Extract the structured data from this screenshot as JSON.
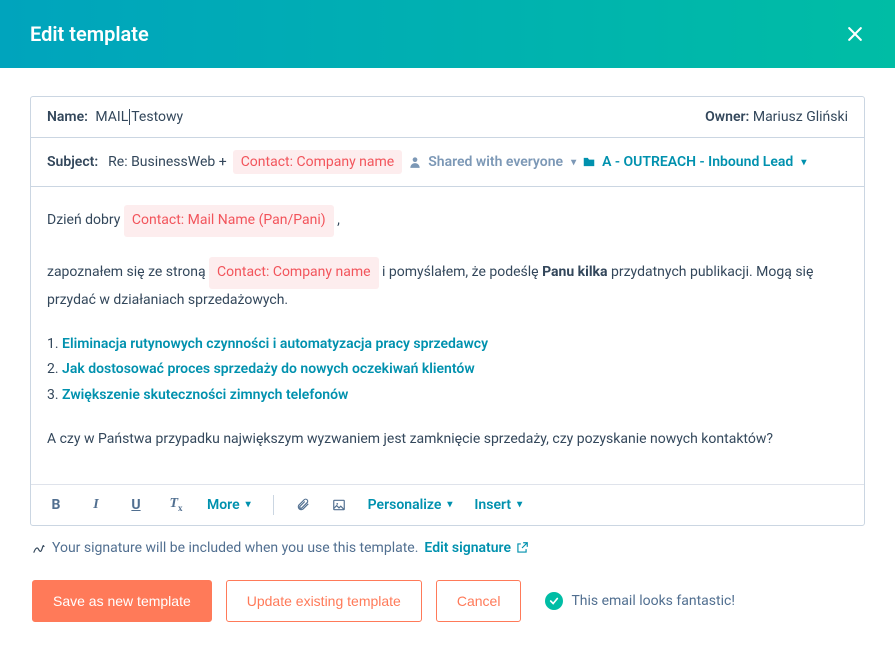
{
  "header": {
    "title": "Edit template"
  },
  "name": {
    "label": "Name:",
    "value_before": "MAIL",
    "value_after": "Testowy"
  },
  "owner": {
    "label": "Owner:",
    "value": "Mariusz Gliński"
  },
  "subject": {
    "label": "Subject:",
    "text": "Re: BusinessWeb +",
    "token": "Contact: Company name"
  },
  "sharing": {
    "label": "Shared with everyone"
  },
  "folder": {
    "label": "A - OUTREACH - Inbound Lead"
  },
  "body": {
    "greeting_prefix": "Dzień dobry ",
    "greeting_token": "Contact: Mail Name (Pan/Pani)",
    "greeting_suffix": ",",
    "p1_a": "zapoznałem się ze stroną ",
    "p1_token": "Contact: Company name",
    "p1_b": " i pomyślałem, że podeślę ",
    "p1_bold": "Panu kilka",
    "p1_c": " przydatnych publikacji. Mogą się przydać w działaniach sprzedażowych.",
    "links": [
      {
        "num": "1. ",
        "text": "Eliminacja rutynowych czynności i automatyzacja pracy sprzedawcy"
      },
      {
        "num": "2. ",
        "text": "Jak dostosować proces sprzedaży do nowych oczekiwań klientów"
      },
      {
        "num": "3. ",
        "text": "Zwiększenie skuteczności zimnych telefonów"
      }
    ],
    "p2": "A czy w Państwa przypadku największym wyzwaniem jest zamknięcie sprzedaży, czy pozyskanie nowych kontaktów?"
  },
  "toolbar": {
    "more": "More",
    "personalize": "Personalize",
    "insert": "Insert"
  },
  "signature": {
    "text": "Your signature will be included when you use this template.",
    "link": "Edit signature"
  },
  "footer": {
    "save": "Save as new template",
    "update": "Update existing template",
    "cancel": "Cancel",
    "status": "This email looks fantastic!"
  }
}
